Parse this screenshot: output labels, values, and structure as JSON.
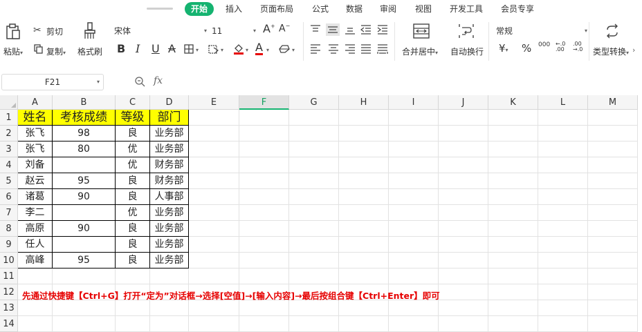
{
  "menu": {
    "tabs": [
      "开始",
      "插入",
      "页面布局",
      "公式",
      "数据",
      "审阅",
      "视图",
      "开发工具",
      "会员专享"
    ],
    "active": "开始"
  },
  "ribbon": {
    "paste": "粘贴",
    "cut": "剪切",
    "copy": "复制",
    "format_painter": "格式刷",
    "font_name": "宋体",
    "font_size": "11",
    "merge_center": "合并居中",
    "wrap_text": "自动换行",
    "number_format": "常规",
    "percent": "%",
    "thousands": "000",
    "type_convert": "类型转换",
    "currency": "¥",
    "bold": "B",
    "italic": "I",
    "underline": "U",
    "strikethrough": "A",
    "font_color": "A"
  },
  "formula_bar": {
    "name_box": "F21",
    "fx": "fx",
    "value": ""
  },
  "sheet": {
    "columns": [
      "A",
      "B",
      "C",
      "D",
      "E",
      "F",
      "G",
      "H",
      "I",
      "J",
      "K",
      "L",
      "M"
    ],
    "selected_column": "F",
    "rows": [
      "1",
      "2",
      "3",
      "4",
      "5",
      "6",
      "7",
      "8",
      "9",
      "10",
      "11",
      "12",
      "13",
      "14"
    ],
    "table": [
      [
        "姓名",
        "考核成绩",
        "等级",
        "部门"
      ],
      [
        "张飞",
        "98",
        "良",
        "业务部"
      ],
      [
        "张飞",
        "80",
        "优",
        "业务部"
      ],
      [
        "刘备",
        "",
        "优",
        "财务部"
      ],
      [
        "赵云",
        "95",
        "良",
        "财务部"
      ],
      [
        "诸葛",
        "90",
        "良",
        "人事部"
      ],
      [
        "李二",
        "",
        "优",
        "业务部"
      ],
      [
        "高原",
        "90",
        "良",
        "业务部"
      ],
      [
        "任人",
        "",
        "良",
        "业务部"
      ],
      [
        "高峰",
        "95",
        "良",
        "业务部"
      ]
    ],
    "note": "先通过快捷键【Ctrl+G】打开“定为”对话框→选择[空值]→[输入内容]→最后按组合键【Ctrl+Enter】即可",
    "header_fill": "#ffff00",
    "note_color": "#e60000"
  },
  "colors": {
    "accent": "#15b370"
  }
}
